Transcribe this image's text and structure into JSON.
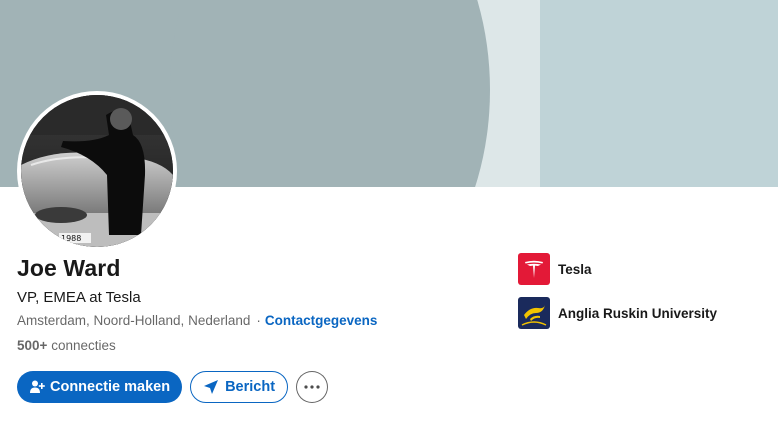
{
  "profile": {
    "name": "Joe Ward",
    "headline": "VP, EMEA at Tesla",
    "location": "Amsterdam, Noord-Holland, Nederland",
    "separator": "·",
    "contact_link": "Contactgegevens",
    "connections_count": "500+",
    "connections_label": "connecties",
    "avatar_plate": "1988"
  },
  "actions": {
    "connect_label": "Connectie maken",
    "message_label": "Bericht"
  },
  "organizations": [
    {
      "name": "Tesla",
      "logo_icon": "tesla-logo-icon",
      "color": "#e31937"
    },
    {
      "name": "Anglia Ruskin University",
      "logo_icon": "anglia-ruskin-logo-icon",
      "color": "#1a2a5c"
    }
  ],
  "colors": {
    "accent": "#0a66c2",
    "banner_main": "#a1b3b6",
    "banner_light": "#dde7e8",
    "banner_right": "#bfd3d7"
  }
}
